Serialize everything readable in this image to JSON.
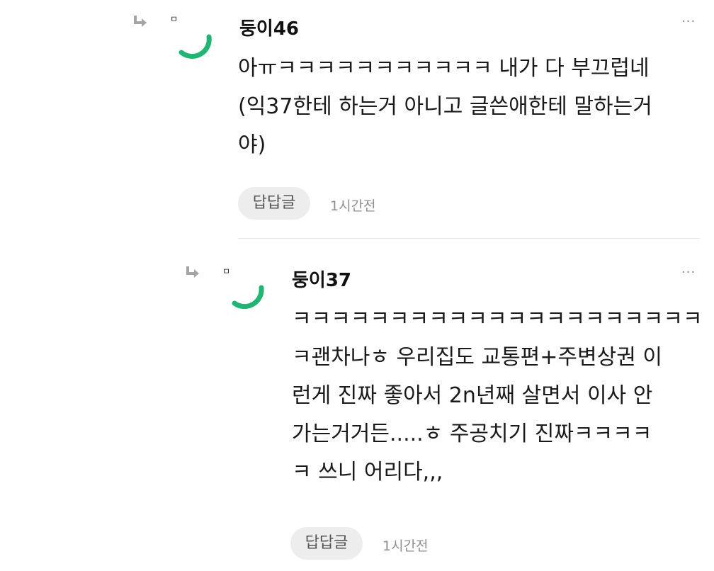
{
  "comments": [
    {
      "author": "둥이46",
      "avatar_glyph": "ㅁ",
      "lines": [
        "아ㅠㅋㅋㅋㅋㅋㅋㅋㅋㅋㅋㅋ 내가 다 부끄럽네",
        "(익37한테 하는거 아니고 글쓴애한테 말하는거",
        "야)"
      ],
      "reply_label": "답답글",
      "time": "1시간전",
      "more": "···"
    },
    {
      "author": "둥이37",
      "avatar_glyph": "ㅁ",
      "lines": [
        "ㅋㅋㅋㅋㅋㅋㅋㅋㅋㅋㅋㅋㅋㅋㅋㅋㅋㅋㅋㅋㅋ",
        "ㅋ괜차나ㅎ 우리집도 교통편+주변상권 이",
        "런게 진짜 좋아서 2n년째 살면서 이사 안",
        "가는거거든.....ㅎ 주공치기 진짜ㅋㅋㅋㅋ",
        "ㅋ 쓰니 어리다,,,"
      ],
      "reply_label": "답답글",
      "time": "1시간전",
      "more": "···"
    }
  ],
  "colors": {
    "avatar_ring": "#21b573",
    "reply_arrow": "#a5a5a5",
    "pill_bg": "#ededed"
  },
  "icons": {
    "reply_arrow": "reply-arrow-icon",
    "avatar": "avatar-ring-icon",
    "more": "more-options-icon"
  }
}
